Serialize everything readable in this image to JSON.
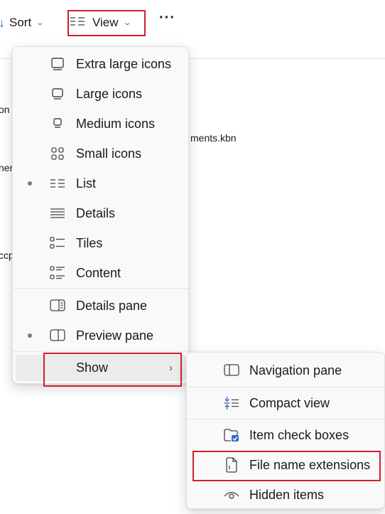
{
  "toolbar": {
    "sort_label": "Sort",
    "view_label": "View",
    "more_label": "···"
  },
  "background_files": {
    "item1": "on",
    "item2": "ments.kbn",
    "item3": "ner",
    "item4": "ccp"
  },
  "view_menu": {
    "items": [
      {
        "label": "Extra large icons",
        "icon": "monitor-xl-icon",
        "selected": false
      },
      {
        "label": "Large icons",
        "icon": "monitor-large-icon",
        "selected": false
      },
      {
        "label": "Medium icons",
        "icon": "monitor-medium-icon",
        "selected": false
      },
      {
        "label": "Small icons",
        "icon": "small-icons-grid-icon",
        "selected": false
      },
      {
        "label": "List",
        "icon": "list-icon",
        "selected": true
      },
      {
        "label": "Details",
        "icon": "details-icon",
        "selected": false
      },
      {
        "label": "Tiles",
        "icon": "tiles-icon",
        "selected": false
      },
      {
        "label": "Content",
        "icon": "content-icon",
        "selected": false
      }
    ],
    "panes": [
      {
        "label": "Details pane",
        "icon": "details-pane-icon",
        "selected": false
      },
      {
        "label": "Preview pane",
        "icon": "preview-pane-icon",
        "selected": true
      }
    ],
    "show_label": "Show"
  },
  "show_submenu": {
    "items": [
      {
        "label": "Navigation pane",
        "icon": "navigation-pane-icon"
      },
      {
        "label": "Compact view",
        "icon": "compact-view-icon"
      },
      {
        "label": "Item check boxes",
        "icon": "check-boxes-icon"
      },
      {
        "label": "File name extensions",
        "icon": "file-extension-icon"
      },
      {
        "label": "Hidden items",
        "icon": "eye-icon"
      }
    ]
  },
  "colors": {
    "highlight_box": "#d0202a",
    "accent_blue": "#2a6bc9",
    "menu_bg": "#f9f9f9"
  }
}
